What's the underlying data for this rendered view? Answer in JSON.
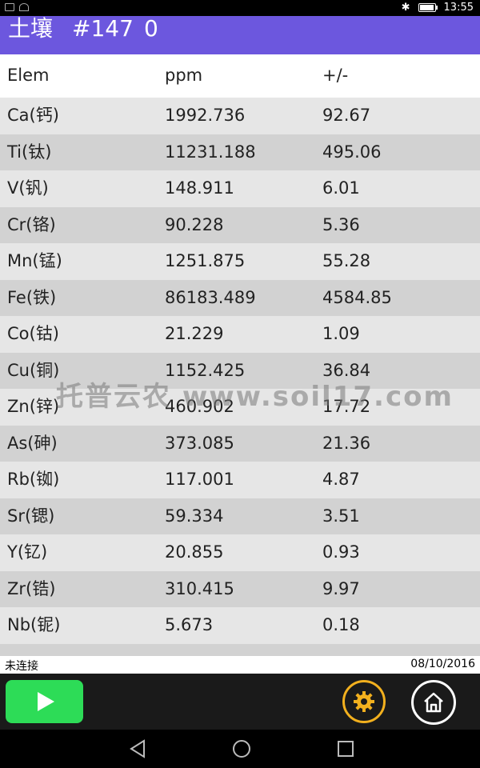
{
  "statusbar": {
    "time": "13:55"
  },
  "header": {
    "title": "土壤",
    "sample_id": "#147",
    "count": "0"
  },
  "table": {
    "columns": [
      "Elem",
      "ppm",
      "+/-"
    ],
    "rows": [
      {
        "elem": "Ca(钙)",
        "ppm": "1992.736",
        "err": "92.67"
      },
      {
        "elem": "Ti(钛)",
        "ppm": "11231.188",
        "err": "495.06"
      },
      {
        "elem": "V(钒)",
        "ppm": "148.911",
        "err": "6.01"
      },
      {
        "elem": "Cr(铬)",
        "ppm": "90.228",
        "err": "5.36"
      },
      {
        "elem": "Mn(锰)",
        "ppm": "1251.875",
        "err": "55.28"
      },
      {
        "elem": "Fe(铁)",
        "ppm": "86183.489",
        "err": "4584.85"
      },
      {
        "elem": "Co(钴)",
        "ppm": "21.229",
        "err": "1.09"
      },
      {
        "elem": "Cu(铜)",
        "ppm": "1152.425",
        "err": "36.84"
      },
      {
        "elem": "Zn(锌)",
        "ppm": "460.902",
        "err": "17.72"
      },
      {
        "elem": "As(砷)",
        "ppm": "373.085",
        "err": "21.36"
      },
      {
        "elem": "Rb(铷)",
        "ppm": "117.001",
        "err": "4.87"
      },
      {
        "elem": "Sr(锶)",
        "ppm": "59.334",
        "err": "3.51"
      },
      {
        "elem": "Y(钇)",
        "ppm": "20.855",
        "err": "0.93"
      },
      {
        "elem": "Zr(锆)",
        "ppm": "310.415",
        "err": "9.97"
      },
      {
        "elem": "Nb(铌)",
        "ppm": "5.673",
        "err": "0.18"
      },
      {
        "elem": "",
        "ppm": "",
        "err": ""
      }
    ]
  },
  "watermark": "托普云农  www.soil17.com",
  "footer": {
    "connection": "未连接",
    "date": "08/10/2016"
  },
  "colors": {
    "header": "#6C57DE",
    "play": "#2ddc57",
    "gear": "#f2b01e"
  },
  "icons": {
    "play": "play-icon",
    "settings": "gear-icon",
    "home": "home-icon"
  }
}
